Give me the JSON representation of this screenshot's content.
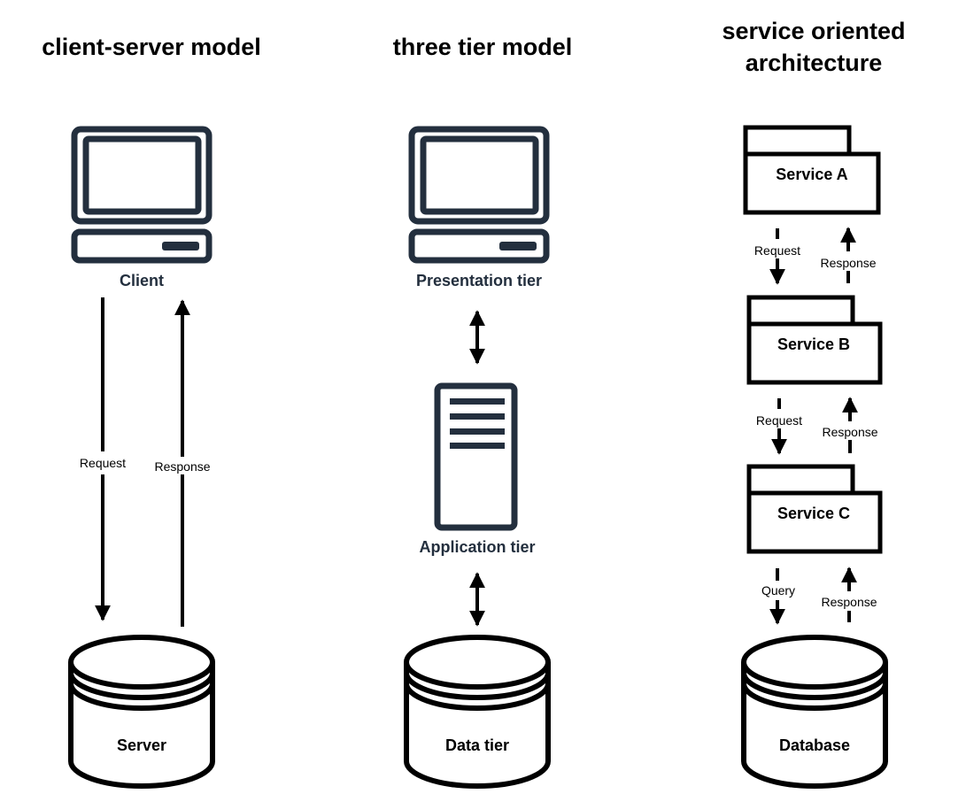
{
  "colors": {
    "icon": "#232f3e",
    "line": "#000000",
    "background": "#ffffff"
  },
  "columns": [
    {
      "title": "client-server model",
      "client_label": "Client",
      "server_label": "Server",
      "request_label": "Request",
      "response_label": "Response"
    },
    {
      "title": "three tier model",
      "presentation_label": "Presentation tier",
      "application_label": "Application tier",
      "data_label": "Data tier"
    },
    {
      "title_line1": "service oriented",
      "title_line2": "architecture",
      "services": [
        {
          "label": "Service A",
          "down_label": "Request",
          "up_label": "Response"
        },
        {
          "label": "Service B",
          "down_label": "Request",
          "up_label": "Response"
        },
        {
          "label": "Service C",
          "down_label": "Query",
          "up_label": "Response"
        }
      ],
      "database_label": "Database"
    }
  ],
  "icons": {
    "client": "desktop-computer-icon",
    "server": "database-cylinder-icon",
    "application": "server-tower-icon",
    "service": "package-folder-icon"
  }
}
